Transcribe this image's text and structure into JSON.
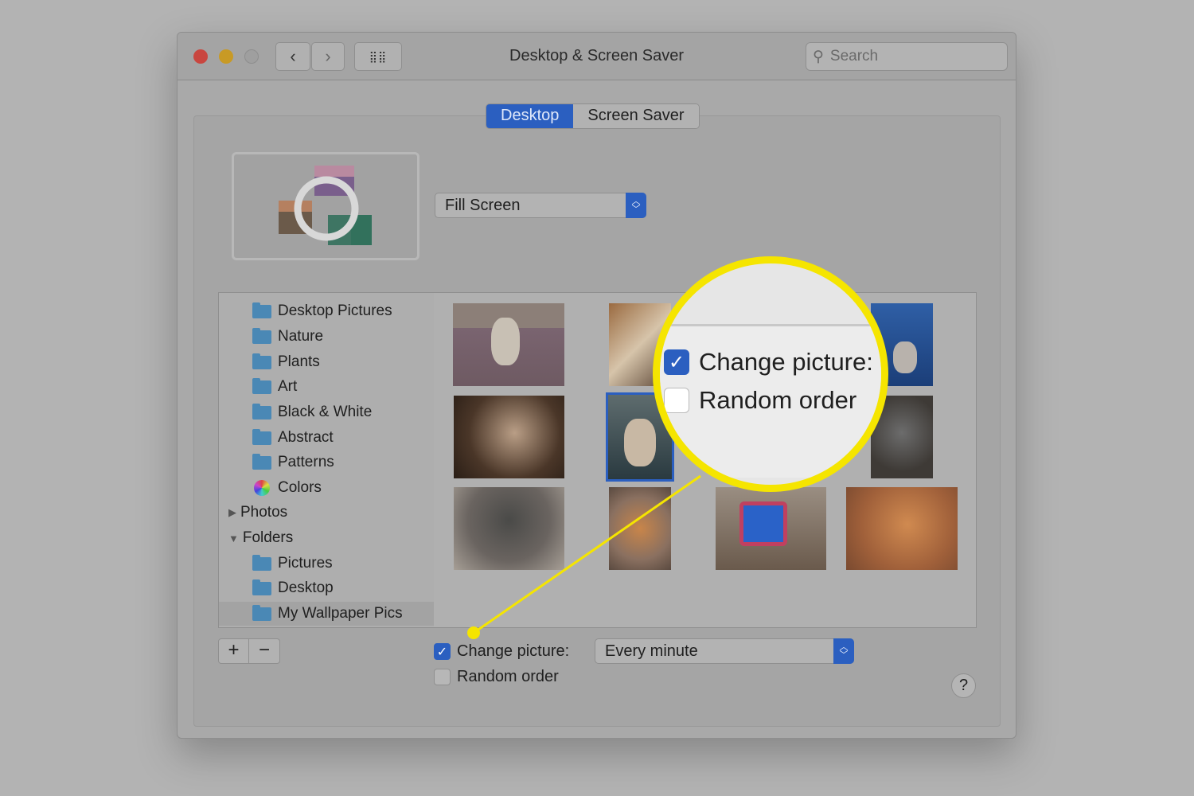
{
  "window": {
    "title": "Desktop & Screen Saver",
    "search_placeholder": "Search"
  },
  "tabs": [
    {
      "label": "Desktop",
      "selected": true
    },
    {
      "label": "Screen Saver",
      "selected": false
    }
  ],
  "fit_popup": {
    "value": "Fill Screen"
  },
  "sidebar": {
    "items": [
      {
        "label": "Desktop Pictures",
        "icon": "folder-icon"
      },
      {
        "label": "Nature",
        "icon": "folder-icon"
      },
      {
        "label": "Plants",
        "icon": "folder-icon"
      },
      {
        "label": "Art",
        "icon": "folder-icon"
      },
      {
        "label": "Black & White",
        "icon": "folder-icon"
      },
      {
        "label": "Abstract",
        "icon": "folder-icon"
      },
      {
        "label": "Patterns",
        "icon": "folder-icon"
      },
      {
        "label": "Colors",
        "icon": "color-wheel-icon"
      },
      {
        "label": "Photos",
        "icon": "disclosure-collapsed-icon"
      },
      {
        "label": "Folders",
        "icon": "disclosure-expanded-icon"
      },
      {
        "label": "Pictures",
        "icon": "pictures-folder-icon"
      },
      {
        "label": "Desktop",
        "icon": "folder-icon"
      },
      {
        "label": "My Wallpaper Pics",
        "icon": "folder-icon",
        "selected": true
      }
    ]
  },
  "add_label": "+",
  "remove_label": "−",
  "change_picture": {
    "label": "Change picture:",
    "checked": true,
    "interval": "Every minute"
  },
  "random_order": {
    "label": "Random order",
    "checked": false
  },
  "help_label": "?",
  "magnifier": {
    "change_picture": "Change picture:",
    "random_order": "Random order"
  },
  "colors": {
    "accent": "#2b5fc0",
    "highlight": "#f5e500"
  }
}
